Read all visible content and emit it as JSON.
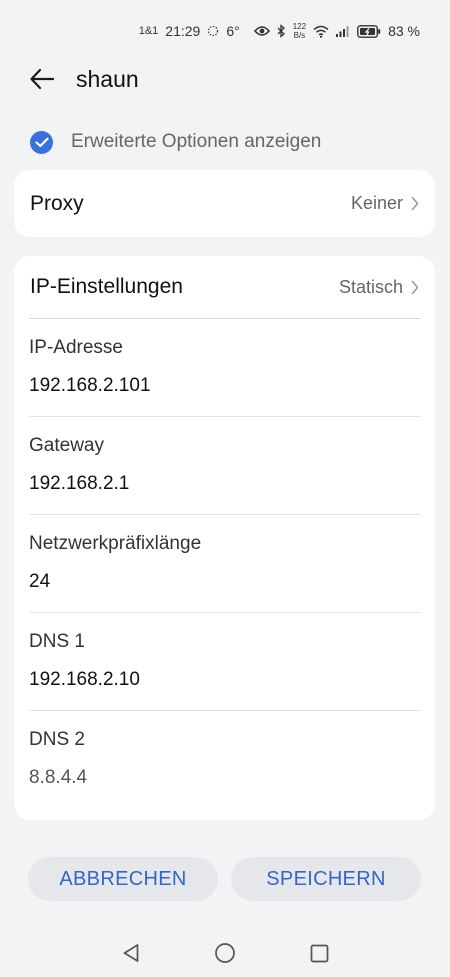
{
  "status_bar": {
    "carrier": "1&1",
    "time": "21:29",
    "temperature": "6°",
    "net_speed_value": "122",
    "net_speed_unit": "B/s",
    "battery": "83 %"
  },
  "header": {
    "title": "shaun",
    "back_icon": "arrow-left-icon"
  },
  "advanced_options": {
    "label": "Erweiterte Optionen anzeigen",
    "checked": true
  },
  "proxy": {
    "title": "Proxy",
    "value": "Keiner"
  },
  "ip_settings": {
    "title": "IP-Einstellungen",
    "value": "Statisch",
    "fields": [
      {
        "label": "IP-Adresse",
        "value": "192.168.2.101"
      },
      {
        "label": "Gateway",
        "value": "192.168.2.1"
      },
      {
        "label": "Netzwerkpräfixlänge",
        "value": "24"
      },
      {
        "label": "DNS 1",
        "value": "192.168.2.10"
      },
      {
        "label": "DNS 2",
        "value": "8.8.4.4"
      }
    ]
  },
  "buttons": {
    "cancel": "ABBRECHEN",
    "save": "SPEICHERN"
  },
  "colors": {
    "accent": "#3366cc",
    "checkbox": "#3a6fe0",
    "background": "#f1f3f5"
  }
}
